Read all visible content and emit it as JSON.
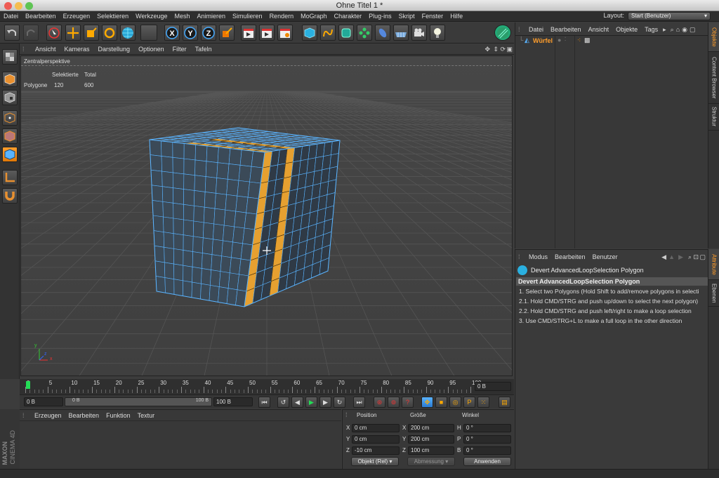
{
  "window": {
    "title": "Ohne Titel 1 *"
  },
  "menu": {
    "items": [
      "Datei",
      "Bearbeiten",
      "Erzeugen",
      "Selektieren",
      "Werkzeuge",
      "Mesh",
      "Animieren",
      "Simulieren",
      "Rendern",
      "MoGraph",
      "Charakter",
      "Plug-ins",
      "Skript",
      "Fenster",
      "Hilfe"
    ]
  },
  "layout": {
    "label": "Layout:",
    "value": "Start (Benutzer)"
  },
  "viewport": {
    "menu": [
      "Ansicht",
      "Kameras",
      "Darstellung",
      "Optionen",
      "Filter",
      "Tafeln"
    ],
    "view_name": "Zentralperspektive",
    "stats": {
      "col_selected": "Selektierte",
      "col_total": "Total",
      "row_label": "Polygone",
      "selected": "120",
      "total": "600"
    },
    "axis": {
      "x": "x",
      "y": "y",
      "z": "z"
    }
  },
  "timeline": {
    "ticks": [
      "0",
      "5",
      "10",
      "15",
      "20",
      "25",
      "30",
      "35",
      "40",
      "45",
      "50",
      "55",
      "60",
      "65",
      "70",
      "75",
      "80",
      "85",
      "90",
      "95",
      "100"
    ],
    "current_frame": "0 B"
  },
  "timecontrols": {
    "start": "0 B",
    "range_start": "0 B",
    "range_end": "100 B",
    "end": "100 B"
  },
  "material": {
    "menu": [
      "Erzeugen",
      "Bearbeiten",
      "Funktion",
      "Textur"
    ],
    "brand1": "MAXON",
    "brand2": "CINEMA 4D"
  },
  "coords": {
    "headers": {
      "position": "Position",
      "size": "Größe",
      "rotation": "Winkel"
    },
    "rows": [
      {
        "axis": "X",
        "pos": "0 cm",
        "saxis": "X",
        "size": "200 cm",
        "raxis": "H",
        "rot": "0 °"
      },
      {
        "axis": "Y",
        "pos": "0 cm",
        "saxis": "Y",
        "size": "200 cm",
        "raxis": "P",
        "rot": "0 °"
      },
      {
        "axis": "Z",
        "pos": "-10 cm",
        "saxis": "Z",
        "size": "100 cm",
        "raxis": "B",
        "rot": "0 °"
      }
    ],
    "mode": "Objekt (Rel)",
    "size_mode": "Abmessung",
    "apply": "Anwenden"
  },
  "objects": {
    "menu": [
      "Datei",
      "Bearbeiten",
      "Ansicht",
      "Objekte",
      "Tags"
    ],
    "items": [
      {
        "name": "Würfel"
      }
    ]
  },
  "right_tabs": {
    "top": [
      "Objekte",
      "Content Browser",
      "Struktur"
    ],
    "bottom": [
      "Attribute",
      "Ebenen"
    ]
  },
  "attributes": {
    "menu": [
      "Modus",
      "Bearbeiten",
      "Benutzer"
    ],
    "title": "Devert AdvancedLoopSelection Polygon",
    "header": "Devert AdvancedLoopSelection Polygon",
    "lines": [
      "1. Select two Polygons (Hold Shift to add/remove polygons in selecti",
      "2.1. Hold CMD/STRG and push up/down to select the next polygon)",
      "2.2. Hold CMD/STRG and push left/right to make a loop selection",
      "3. Use CMD/STRG+L to make a full loop in the other direction"
    ]
  },
  "colors": {
    "accent": "#ff9e2c",
    "selection": "#f0a030",
    "wire": "#5ab4ff",
    "background": "#3c3c3c"
  }
}
